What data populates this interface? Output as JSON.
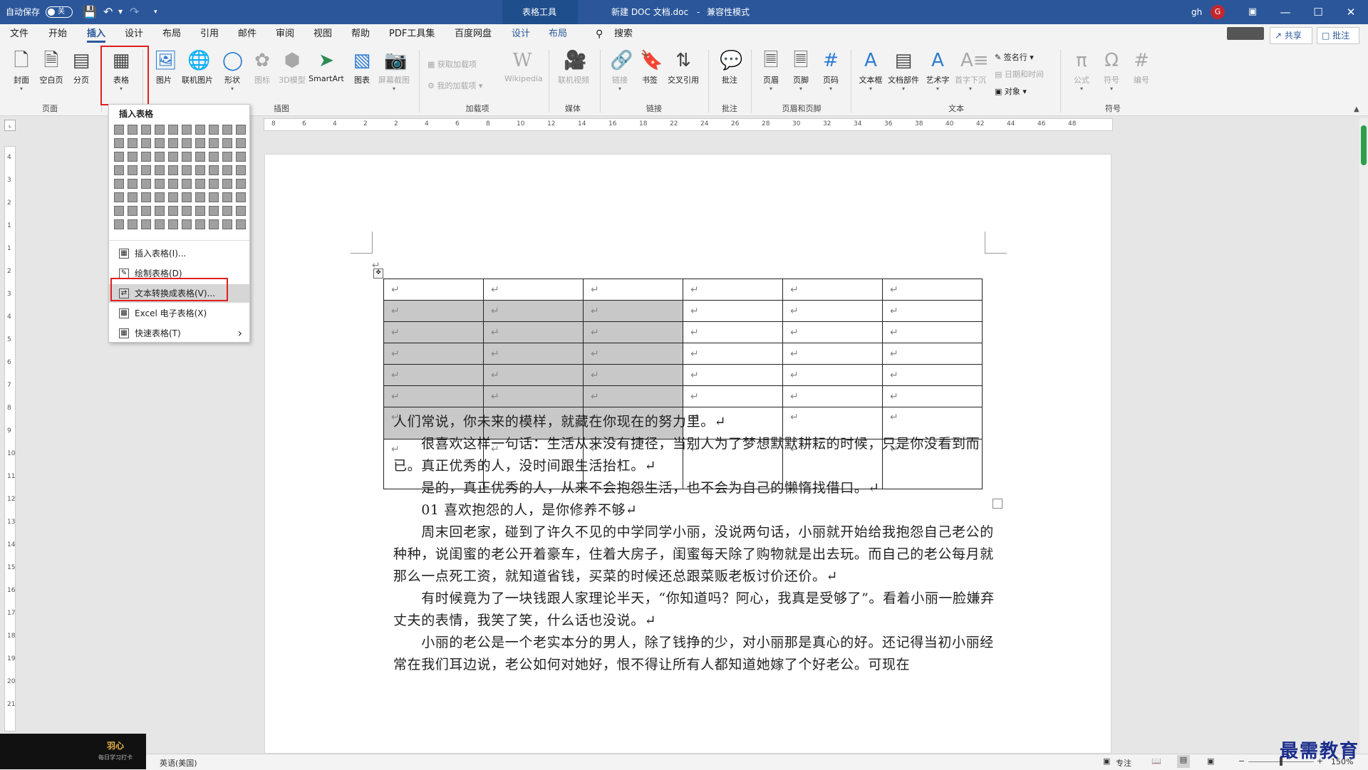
{
  "titlebar": {
    "autosave_label": "自动保存",
    "autosave_state": "关",
    "context_tab": "表格工具",
    "doc_title": "新建 DOC 文档.doc",
    "separator": "-",
    "mode": "兼容性模式",
    "user": "gh",
    "avatar_letter": "G"
  },
  "tabs": [
    "文件",
    "开始",
    "插入",
    "设计",
    "布局",
    "引用",
    "邮件",
    "审阅",
    "视图",
    "帮助",
    "PDF工具集",
    "百度网盘",
    "设计",
    "布局"
  ],
  "active_tab": "插入",
  "search_label": "搜索",
  "share_label": "共享",
  "comment_label": "批注",
  "ribbon": {
    "page_group": {
      "label": "页面",
      "buttons": [
        "封面",
        "空白页",
        "分页"
      ]
    },
    "table_button": "表格",
    "illustrations": {
      "label": "插图",
      "buttons": [
        "图片",
        "联机图片",
        "形状",
        "图标",
        "3D模型",
        "SmartArt",
        "图表",
        "屏幕截图"
      ]
    },
    "addins": {
      "label": "加载项",
      "get": "获取加载项",
      "mine": "我的加载项",
      "wikipedia": "Wikipedia"
    },
    "media": {
      "label": "媒体",
      "video": "联机视频"
    },
    "links": {
      "label": "链接",
      "buttons": [
        "链接",
        "书签",
        "交叉引用"
      ]
    },
    "comments": {
      "label": "批注",
      "button": "批注"
    },
    "header_footer": {
      "label": "页眉和页脚",
      "buttons": [
        "页眉",
        "页脚",
        "页码"
      ]
    },
    "text": {
      "label": "文本",
      "buttons": [
        "文本框",
        "文档部件",
        "艺术字",
        "首字下沉"
      ],
      "signature": "签名行",
      "datetime": "日期和时间",
      "object": "对象"
    },
    "symbols": {
      "label": "符号",
      "buttons": [
        "公式",
        "符号",
        "编号"
      ]
    }
  },
  "dropdown": {
    "title": "插入表格",
    "items": [
      {
        "icon": "insert-table-icon",
        "label": "插入表格(I)..."
      },
      {
        "icon": "draw-table-icon",
        "label": "绘制表格(D)"
      },
      {
        "icon": "text-to-table-icon",
        "label": "文本转换成表格(V)..."
      },
      {
        "icon": "excel-table-icon",
        "label": "Excel 电子表格(X)"
      },
      {
        "icon": "quick-table-icon",
        "label": "快速表格(T)"
      }
    ],
    "highlighted_index": 2
  },
  "ruler": {
    "h_marks": [
      "8",
      "6",
      "4",
      "2",
      "2",
      "4",
      "6",
      "8",
      "10",
      "12",
      "14",
      "16",
      "18",
      "22",
      "24",
      "26",
      "28",
      "30",
      "32",
      "34",
      "36",
      "38",
      "40",
      "42",
      "44",
      "46",
      "48"
    ],
    "v_marks": [
      "4",
      "3",
      "2",
      "1",
      "1",
      "2",
      "3",
      "4",
      "5",
      "6",
      "7",
      "8",
      "9",
      "10",
      "11",
      "12",
      "13",
      "14",
      "15",
      "16",
      "17",
      "18",
      "19",
      "20",
      "21"
    ]
  },
  "doc_table": {
    "rows": 8,
    "cols": 6,
    "cell_mark": "↵",
    "selected_rows": [
      1,
      2,
      3,
      4,
      5,
      6
    ],
    "selected_cols": [
      0,
      1,
      2
    ]
  },
  "paragraph_mark": "↵",
  "body_paragraphs": [
    "人们常说，你未来的模样，就藏在你现在的努力里。↵",
    "　　很喜欢这样一句话：生活从来没有捷径，当别人为了梦想默默耕耘的时候，只是你没看到而已。真正优秀的人，没时间跟生活抬杠。↵",
    "　　是的，真正优秀的人，从来不会抱怨生活，也不会为自己的懒惰找借口。↵",
    "　　01  喜欢抱怨的人，是你修养不够↵",
    "　　周末回老家，碰到了许久不见的中学同学小丽，没说两句话，小丽就开始给我抱怨自己老公的种种，说闺蜜的老公开着豪车，住着大房子，闺蜜每天除了购物就是出去玩。而自己的老公每月就那么一点死工资，就知道省钱，买菜的时候还总跟菜贩老板讨价还价。↵",
    "　　有时候竟为了一块钱跟人家理论半天，“你知道吗？阿心，我真是受够了”。看着小丽一脸嫌弃丈夫的表情，我笑了笑，什么话也没说。↵",
    "　　小丽的老公是一个老实本分的男人，除了钱挣的少，对小丽那是真心的好。还记得当初小丽经常在我们耳边说，老公如何对她好，恨不得让所有人都知道她嫁了个好老公。可现在"
  ],
  "status": {
    "language": "英语(美国)",
    "focus": "专注",
    "zoom": "150%"
  },
  "thumbnail": {
    "line1": "羽心",
    "line2": "每日学习打卡"
  },
  "watermark": "最需教育",
  "colors": {
    "brand": "#2b579a",
    "highlight_box": "#e02020",
    "selection": "#c8c8c8"
  }
}
